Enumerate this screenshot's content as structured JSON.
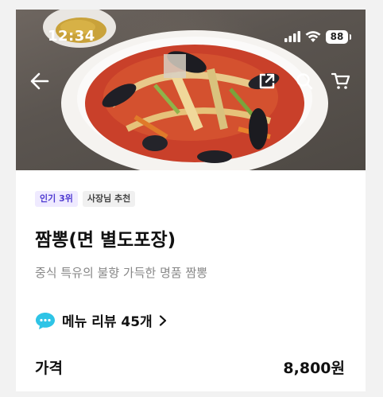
{
  "status_bar": {
    "time": "12:34",
    "battery": "88"
  },
  "nav": {
    "back_icon": "back-arrow-icon",
    "share_icon": "share-icon",
    "search_icon": "search-icon",
    "cart_icon": "cart-icon"
  },
  "menu": {
    "badges": [
      "인기 3위",
      "사장님 추천"
    ],
    "name": "짬뽕(면 별도포장)",
    "description": "중식 특유의 불향 가득한 명품 짬뽕",
    "review_link": "메뉴 리뷰 45개",
    "price_label": "가격",
    "price": "8,800원"
  },
  "colors": {
    "badge_rank_bg": "#efeaff",
    "badge_rank_text": "#4f3bd1",
    "review_icon": "#2ec4e6"
  }
}
